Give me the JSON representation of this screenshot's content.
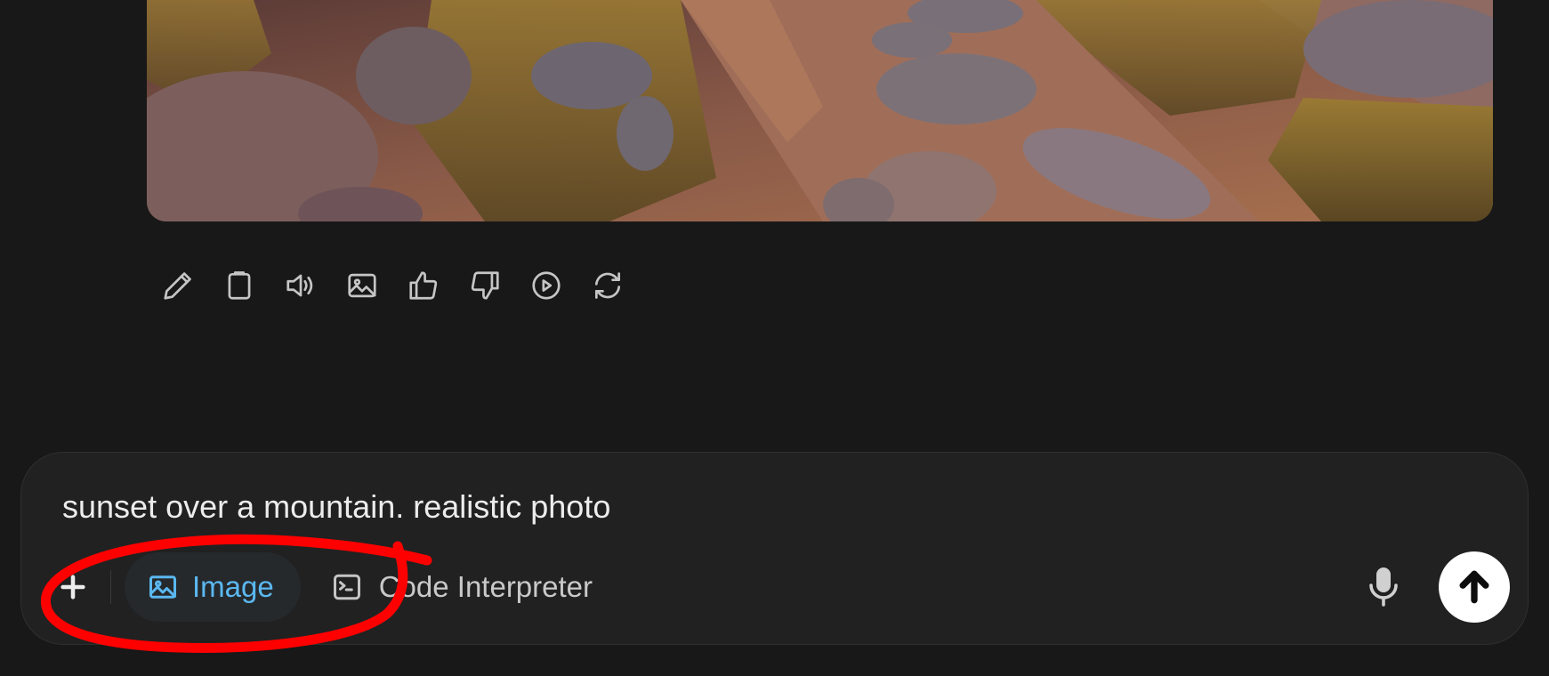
{
  "generated_image": {
    "subject": "sunset over a mountain"
  },
  "message_actions": [
    {
      "name": "edit-icon",
      "label": "Edit"
    },
    {
      "name": "copy-icon",
      "label": "Copy"
    },
    {
      "name": "read-aloud-icon",
      "label": "Read aloud"
    },
    {
      "name": "image-icon",
      "label": "Image"
    },
    {
      "name": "thumbs-up-icon",
      "label": "Good response"
    },
    {
      "name": "thumbs-down-icon",
      "label": "Bad response"
    },
    {
      "name": "play-icon",
      "label": "Play"
    },
    {
      "name": "regenerate-icon",
      "label": "Regenerate"
    }
  ],
  "composer": {
    "prompt_text": "sunset over a mountain. realistic photo",
    "tools": {
      "image_label": "Image",
      "code_interpreter_label": "Code Interpreter"
    }
  },
  "colors": {
    "background": "#181818",
    "composer_bg": "#212121",
    "accent_blue": "#5bb8f0",
    "annotation_red": "#ff0000"
  }
}
